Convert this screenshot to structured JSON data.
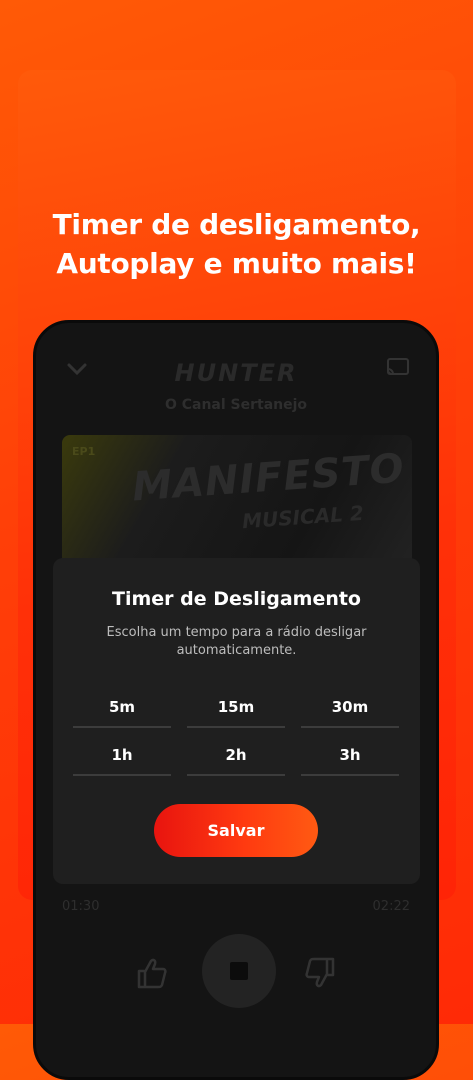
{
  "promo": {
    "headline_line1": "Timer de desligamento,",
    "headline_line2_regular": "Autoplay e ",
    "headline_line2_bold": "muito mais!"
  },
  "player": {
    "logo_text": "HUNTER",
    "station_name": "O Canal Sertanejo",
    "episode_badge": "EP1",
    "artwork_title": "MANIFESTO",
    "artwork_subtitle": "MUSICAL 2",
    "elapsed_time": "01:30",
    "total_time": "02:22",
    "icons": {
      "collapse": "chevron-down-icon",
      "cast": "cast-icon",
      "like": "thumbs-up-icon",
      "stop": "stop-icon",
      "dislike": "thumbs-down-icon"
    }
  },
  "timer_dialog": {
    "title": "Timer de Desligamento",
    "description": "Escolha um tempo para a rádio desligar automaticamente.",
    "options": [
      "5m",
      "15m",
      "30m",
      "1h",
      "2h",
      "3h"
    ],
    "save_label": "Salvar"
  },
  "colors": {
    "background_orange": "#ff4208",
    "phone_body": "#141414",
    "dialog_bg": "#1f1f1f",
    "accent_red": "#e8140f",
    "accent_orange": "#ff5a12"
  }
}
